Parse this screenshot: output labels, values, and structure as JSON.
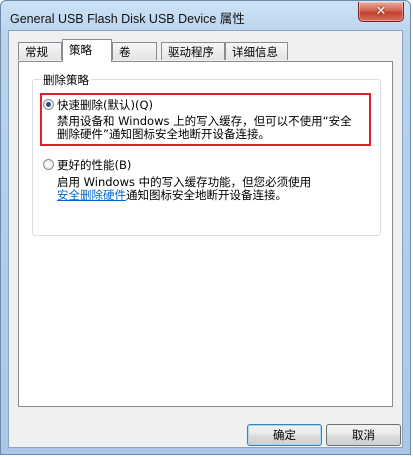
{
  "window": {
    "title": "General USB Flash Disk USB Device 属性",
    "close_symbol": "✕"
  },
  "tabs": [
    {
      "label": "常规",
      "active": false
    },
    {
      "label": "策略",
      "active": true
    },
    {
      "label": "卷",
      "active": false
    },
    {
      "label": "驱动程序",
      "active": false
    },
    {
      "label": "详细信息",
      "active": false
    }
  ],
  "policy": {
    "group_label": "删除策略",
    "quick_removal": {
      "label": "快速删除(默认)(Q)",
      "checked": true,
      "desc_line1": "禁用设备和 Windows 上的写入缓存，但可以不使用“安全",
      "desc_line2": "删除硬件”通知图标安全地断开设备连接。"
    },
    "better_performance": {
      "label": "更好的性能(B)",
      "checked": false,
      "desc_line1": "启用 Windows 中的写入缓存功能，但您必须使用",
      "desc_link": "安全删除硬件",
      "desc_line2_rest": "通知图标安全地断开设备连接。"
    }
  },
  "buttons": {
    "ok": "确定",
    "cancel": "取消"
  },
  "colors": {
    "highlight": "#d9232b",
    "link": "#0066cc"
  }
}
